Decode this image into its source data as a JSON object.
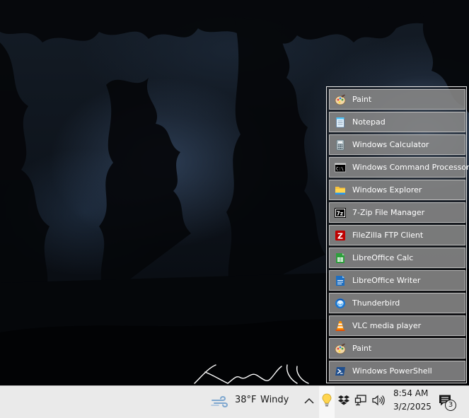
{
  "popup": {
    "items": [
      {
        "label": "Paint",
        "icon": "paint-icon"
      },
      {
        "label": "Notepad",
        "icon": "notepad-icon"
      },
      {
        "label": "Windows Calculator",
        "icon": "calculator-icon"
      },
      {
        "label": "Windows Command Processor",
        "icon": "cmd-icon"
      },
      {
        "label": "Windows Explorer",
        "icon": "folder-icon"
      },
      {
        "label": "7-Zip File Manager",
        "icon": "7zip-icon"
      },
      {
        "label": "FileZilla FTP Client",
        "icon": "filezilla-icon"
      },
      {
        "label": "LibreOffice Calc",
        "icon": "libreoffice-calc-icon"
      },
      {
        "label": "LibreOffice Writer",
        "icon": "libreoffice-writer-icon"
      },
      {
        "label": "Thunderbird",
        "icon": "thunderbird-icon"
      },
      {
        "label": "VLC media player",
        "icon": "vlc-icon"
      },
      {
        "label": "Paint",
        "icon": "paint-icon"
      },
      {
        "label": "Windows PowerShell",
        "icon": "powershell-icon"
      }
    ]
  },
  "taskbar": {
    "weather": {
      "temp": "38°F",
      "condition": "Windy",
      "icon": "wind-icon"
    },
    "tray_icons": [
      "chevron-up-icon",
      "bulb-icon",
      "dropbox-icon",
      "network-icon",
      "volume-icon"
    ],
    "clock": {
      "time": "8:54 AM",
      "date": "3/2/2025"
    },
    "notifications": {
      "count": "3",
      "icon": "notification-icon"
    }
  },
  "colors": {
    "popup_item_bg": "#878787",
    "taskbar_bg": "#eaeaea"
  }
}
